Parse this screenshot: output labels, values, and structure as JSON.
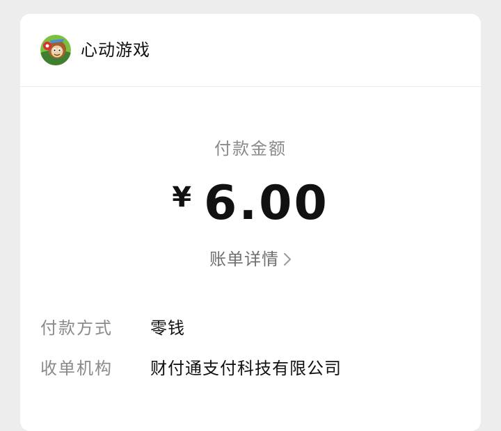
{
  "merchant": {
    "name": "心动游戏",
    "avatar_icon": "game-avatar-icon"
  },
  "payment": {
    "amount_label": "付款金额",
    "currency_symbol": "¥",
    "amount": "6.00",
    "bill_details_label": "账单详情"
  },
  "details": [
    {
      "label": "付款方式",
      "value": "零钱"
    },
    {
      "label": "收单机构",
      "value": "财付通支付科技有限公司"
    }
  ],
  "colors": {
    "background": "#ededed",
    "card": "#ffffff",
    "primary_text": "#111111",
    "secondary_text": "#8a8a8a"
  }
}
